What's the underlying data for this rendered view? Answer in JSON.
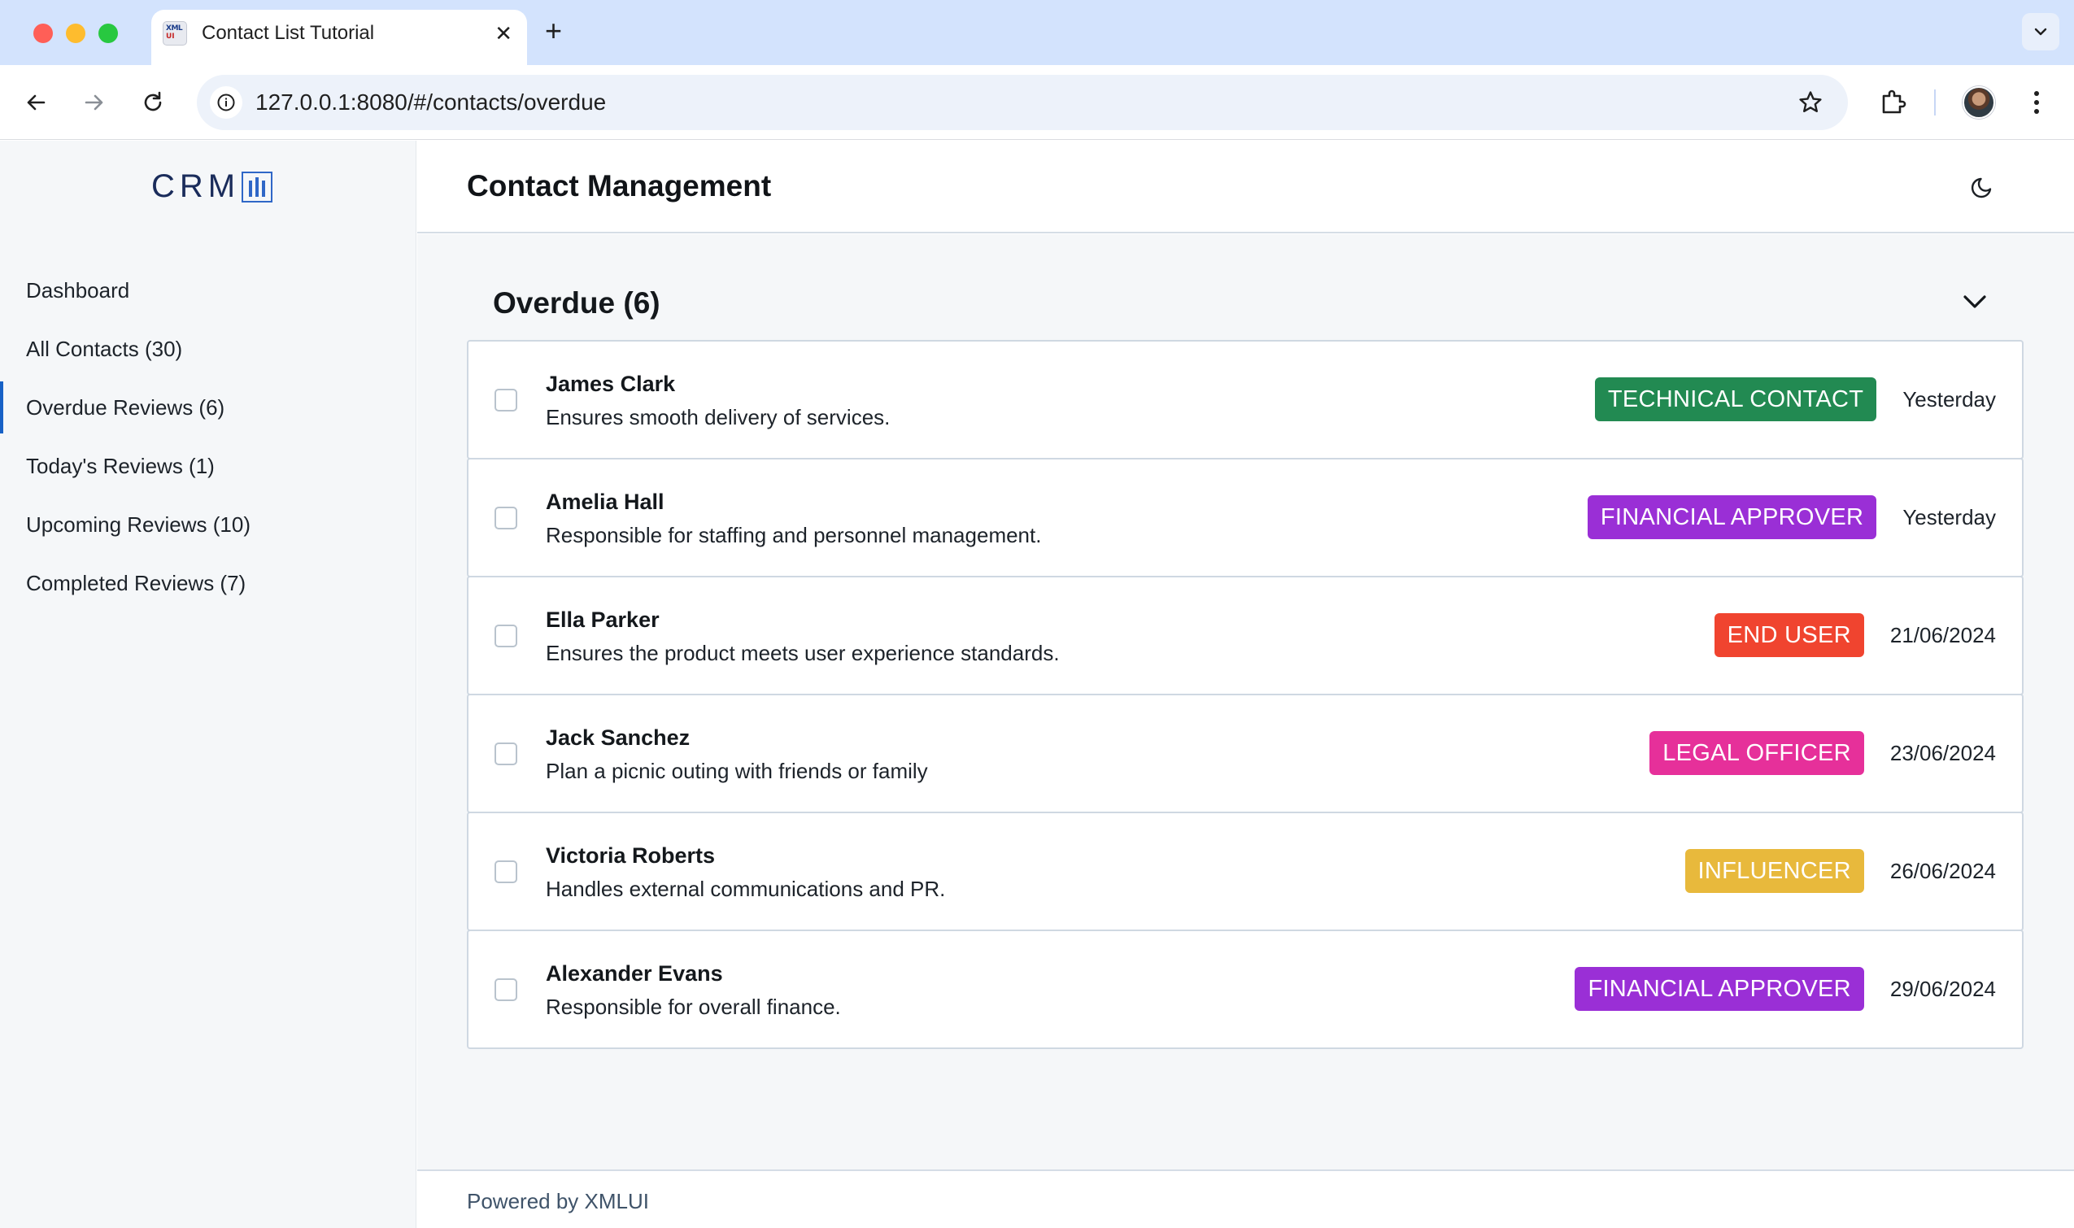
{
  "browser": {
    "tab_title": "Contact List Tutorial",
    "favicon_top": "XML",
    "favicon_bottom": "UI",
    "url": "127.0.0.1:8080/#/contacts/overdue"
  },
  "sidebar": {
    "logo": "CRM",
    "items": [
      {
        "label": "Dashboard",
        "active": false
      },
      {
        "label": "All Contacts (30)",
        "active": false
      },
      {
        "label": "Overdue Reviews (6)",
        "active": true
      },
      {
        "label": "Today's Reviews (1)",
        "active": false
      },
      {
        "label": "Upcoming Reviews (10)",
        "active": false
      },
      {
        "label": "Completed Reviews (7)",
        "active": false
      }
    ]
  },
  "header": {
    "title": "Contact Management",
    "theme_icon": "moon-icon"
  },
  "group": {
    "title": "Overdue (6)",
    "toggle_icon": "chevron-down-icon"
  },
  "contacts": [
    {
      "name": "James Clark",
      "description": "Ensures smooth delivery of services.",
      "badge": "TECHNICAL CONTACT",
      "badge_color": "#228a52",
      "date": "Yesterday"
    },
    {
      "name": "Amelia Hall",
      "description": "Responsible for staffing and personnel management.",
      "badge": "FINANCIAL APPROVER",
      "badge_color": "#9a2fd6",
      "date": "Yesterday"
    },
    {
      "name": "Ella Parker",
      "description": "Ensures the product meets user experience standards.",
      "badge": "END USER",
      "badge_color": "#f0442f",
      "date": "21/06/2024"
    },
    {
      "name": "Jack Sanchez",
      "description": "Plan a picnic outing with friends or family",
      "badge": "LEGAL OFFICER",
      "badge_color": "#e6309a",
      "date": "23/06/2024"
    },
    {
      "name": "Victoria Roberts",
      "description": "Handles external communications and PR.",
      "badge": "INFLUENCER",
      "badge_color": "#e8b93c",
      "date": "26/06/2024"
    },
    {
      "name": "Alexander Evans",
      "description": "Responsible for overall finance.",
      "badge": "FINANCIAL APPROVER",
      "badge_color": "#9a2fd6",
      "date": "29/06/2024"
    }
  ],
  "footer": {
    "text": "Powered by XMLUI"
  },
  "colors": {
    "accent": "#1761c6",
    "sidebar_bg": "#f5f7f9",
    "tabbar_bg": "#d3e3fd"
  }
}
